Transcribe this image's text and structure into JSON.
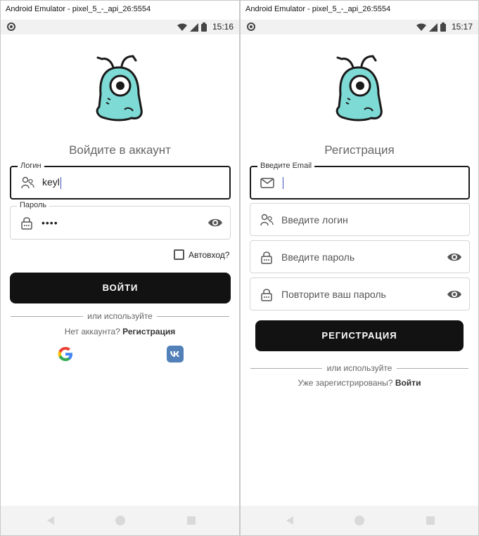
{
  "left": {
    "window_title": "Android Emulator - pixel_5_-_api_26:5554",
    "status_time": "15:16",
    "heading": "Войдите в аккаунт",
    "login_field": {
      "label": "Логин",
      "value": "keyl"
    },
    "password_field": {
      "label": "Пароль",
      "value": "••••"
    },
    "autologin_label": "Автовход?",
    "login_button": "ВОЙТИ",
    "divider_text": "или используйте",
    "no_account_text": "Нет аккаунта?",
    "register_link": "Регистрация",
    "social": {
      "google_icon": "google-logo-icon",
      "vk_icon": "vk-logo-icon"
    }
  },
  "right": {
    "window_title": "Android Emulator - pixel_5_-_api_26:5554",
    "status_time": "15:17",
    "heading": "Регистрация",
    "email_field": {
      "label": "Введите Email",
      "value": ""
    },
    "login_field": {
      "placeholder": "Введите логин"
    },
    "password_field": {
      "placeholder": "Введите пароль"
    },
    "repeat_password_field": {
      "placeholder": "Повторите ваш пароль"
    },
    "register_button": "РЕГИСТРАЦИЯ",
    "divider_text": "или используйте",
    "registered_text": "Уже зарегистрированы?",
    "login_link": "Войти"
  },
  "colors": {
    "accent_dark": "#121212",
    "mascot_teal": "#7ddad5",
    "google_blue": "#4285F4",
    "vk_blue": "#5181b8"
  }
}
